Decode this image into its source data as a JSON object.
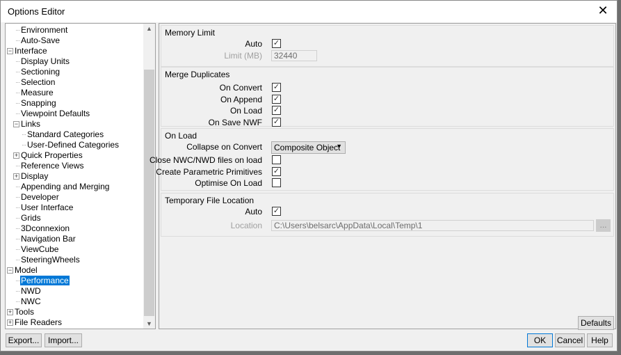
{
  "window": {
    "title": "Options Editor",
    "close": "✕"
  },
  "tree": {
    "items": [
      {
        "label": "Environment",
        "level": 1
      },
      {
        "label": "Auto-Save",
        "level": 1
      },
      {
        "label": "Interface",
        "level": 0,
        "exp": "−"
      },
      {
        "label": "Display Units",
        "level": 1
      },
      {
        "label": "Sectioning",
        "level": 1
      },
      {
        "label": "Selection",
        "level": 1
      },
      {
        "label": "Measure",
        "level": 1
      },
      {
        "label": "Snapping",
        "level": 1
      },
      {
        "label": "Viewpoint Defaults",
        "level": 1
      },
      {
        "label": "Links",
        "level": 1,
        "exp": "−"
      },
      {
        "label": "Standard Categories",
        "level": 2
      },
      {
        "label": "User-Defined Categories",
        "level": 2
      },
      {
        "label": "Quick Properties",
        "level": 1,
        "exp": "+"
      },
      {
        "label": "Reference Views",
        "level": 1
      },
      {
        "label": "Display",
        "level": 1,
        "exp": "+"
      },
      {
        "label": "Appending and Merging",
        "level": 1
      },
      {
        "label": "Developer",
        "level": 1
      },
      {
        "label": "User Interface",
        "level": 1
      },
      {
        "label": "Grids",
        "level": 1
      },
      {
        "label": "3Dconnexion",
        "level": 1
      },
      {
        "label": "Navigation Bar",
        "level": 1
      },
      {
        "label": "ViewCube",
        "level": 1
      },
      {
        "label": "SteeringWheels",
        "level": 1
      },
      {
        "label": "Model",
        "level": 0,
        "exp": "−"
      },
      {
        "label": "Performance",
        "level": 1,
        "selected": true
      },
      {
        "label": "NWD",
        "level": 1
      },
      {
        "label": "NWC",
        "level": 1
      },
      {
        "label": "Tools",
        "level": 0,
        "exp": "+"
      },
      {
        "label": "File Readers",
        "level": 0,
        "exp": "+"
      }
    ]
  },
  "memory": {
    "title": "Memory Limit",
    "auto_label": "Auto",
    "auto": "✓",
    "limit_label": "Limit (MB)",
    "limit_value": "32440"
  },
  "merge": {
    "title": "Merge Duplicates",
    "on_convert": "On Convert",
    "on_append": "On Append",
    "on_load": "On Load",
    "on_save": "On Save NWF",
    "check": "✓"
  },
  "onload": {
    "title": "On Load",
    "collapse_label": "Collapse on Convert",
    "collapse_value": "Composite Object",
    "close_label": "Close NWC/NWD files on load",
    "param_label": "Create Parametric Primitives",
    "optimise_label": "Optimise On Load",
    "check": "✓"
  },
  "temp": {
    "title": "Temporary File Location",
    "auto_label": "Auto",
    "check": "✓",
    "location_label": "Location",
    "location_value": "C:\\Users\\belsarc\\AppData\\Local\\Temp\\1",
    "browse": "..."
  },
  "buttons": {
    "defaults": "Defaults",
    "export": "Export...",
    "import": "Import...",
    "ok": "OK",
    "cancel": "Cancel",
    "help": "Help"
  }
}
